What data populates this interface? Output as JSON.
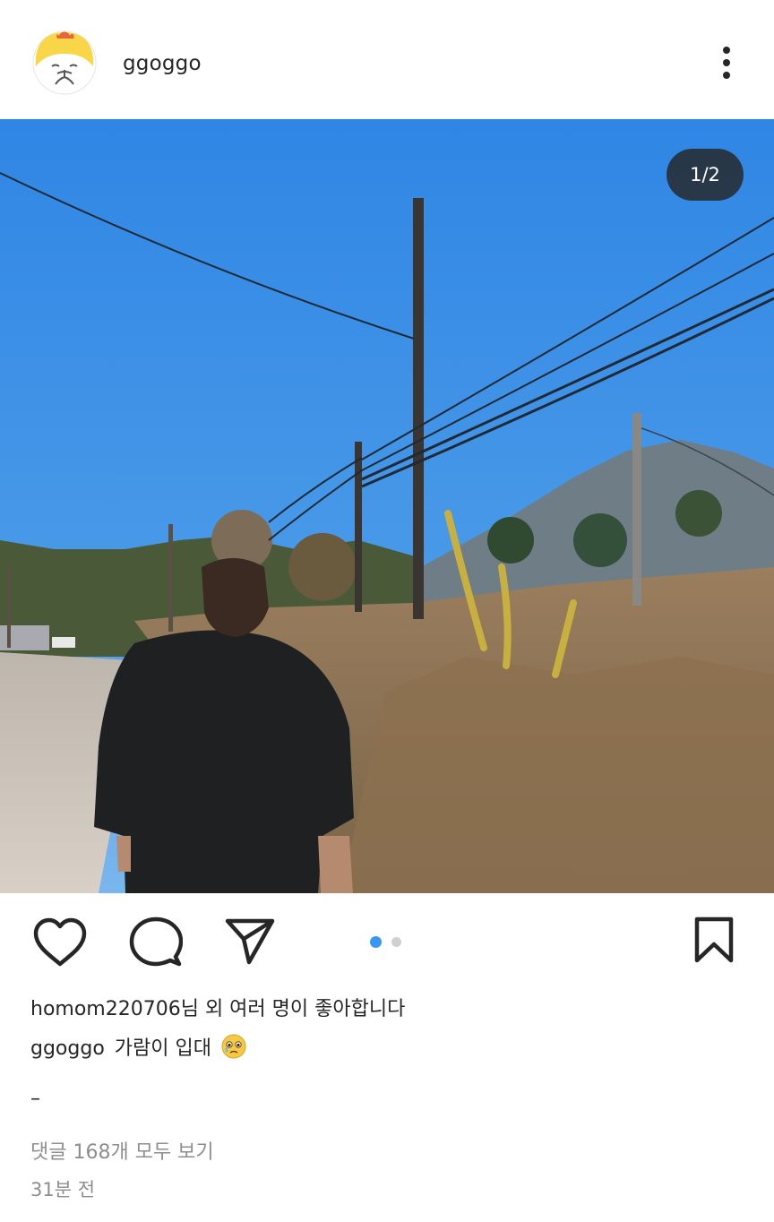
{
  "post": {
    "username": "ggoggo",
    "image_counter": "1/2",
    "likes_text": "homom220706님 외 여러 명이 좋아합니다",
    "caption_user": "ggoggo",
    "caption_text": "가람이 입대",
    "caption_emoji": "face-holding-back-tears",
    "separator": "–",
    "view_comments": "댓글 168개 모두 보기",
    "time_ago": "31분 전",
    "carousel": {
      "count": 2,
      "active_index": 0
    }
  },
  "colors": {
    "accent_blue": "#3897f0",
    "text": "#262626",
    "muted": "#8e8e8e",
    "sky": "#3c8be6"
  }
}
